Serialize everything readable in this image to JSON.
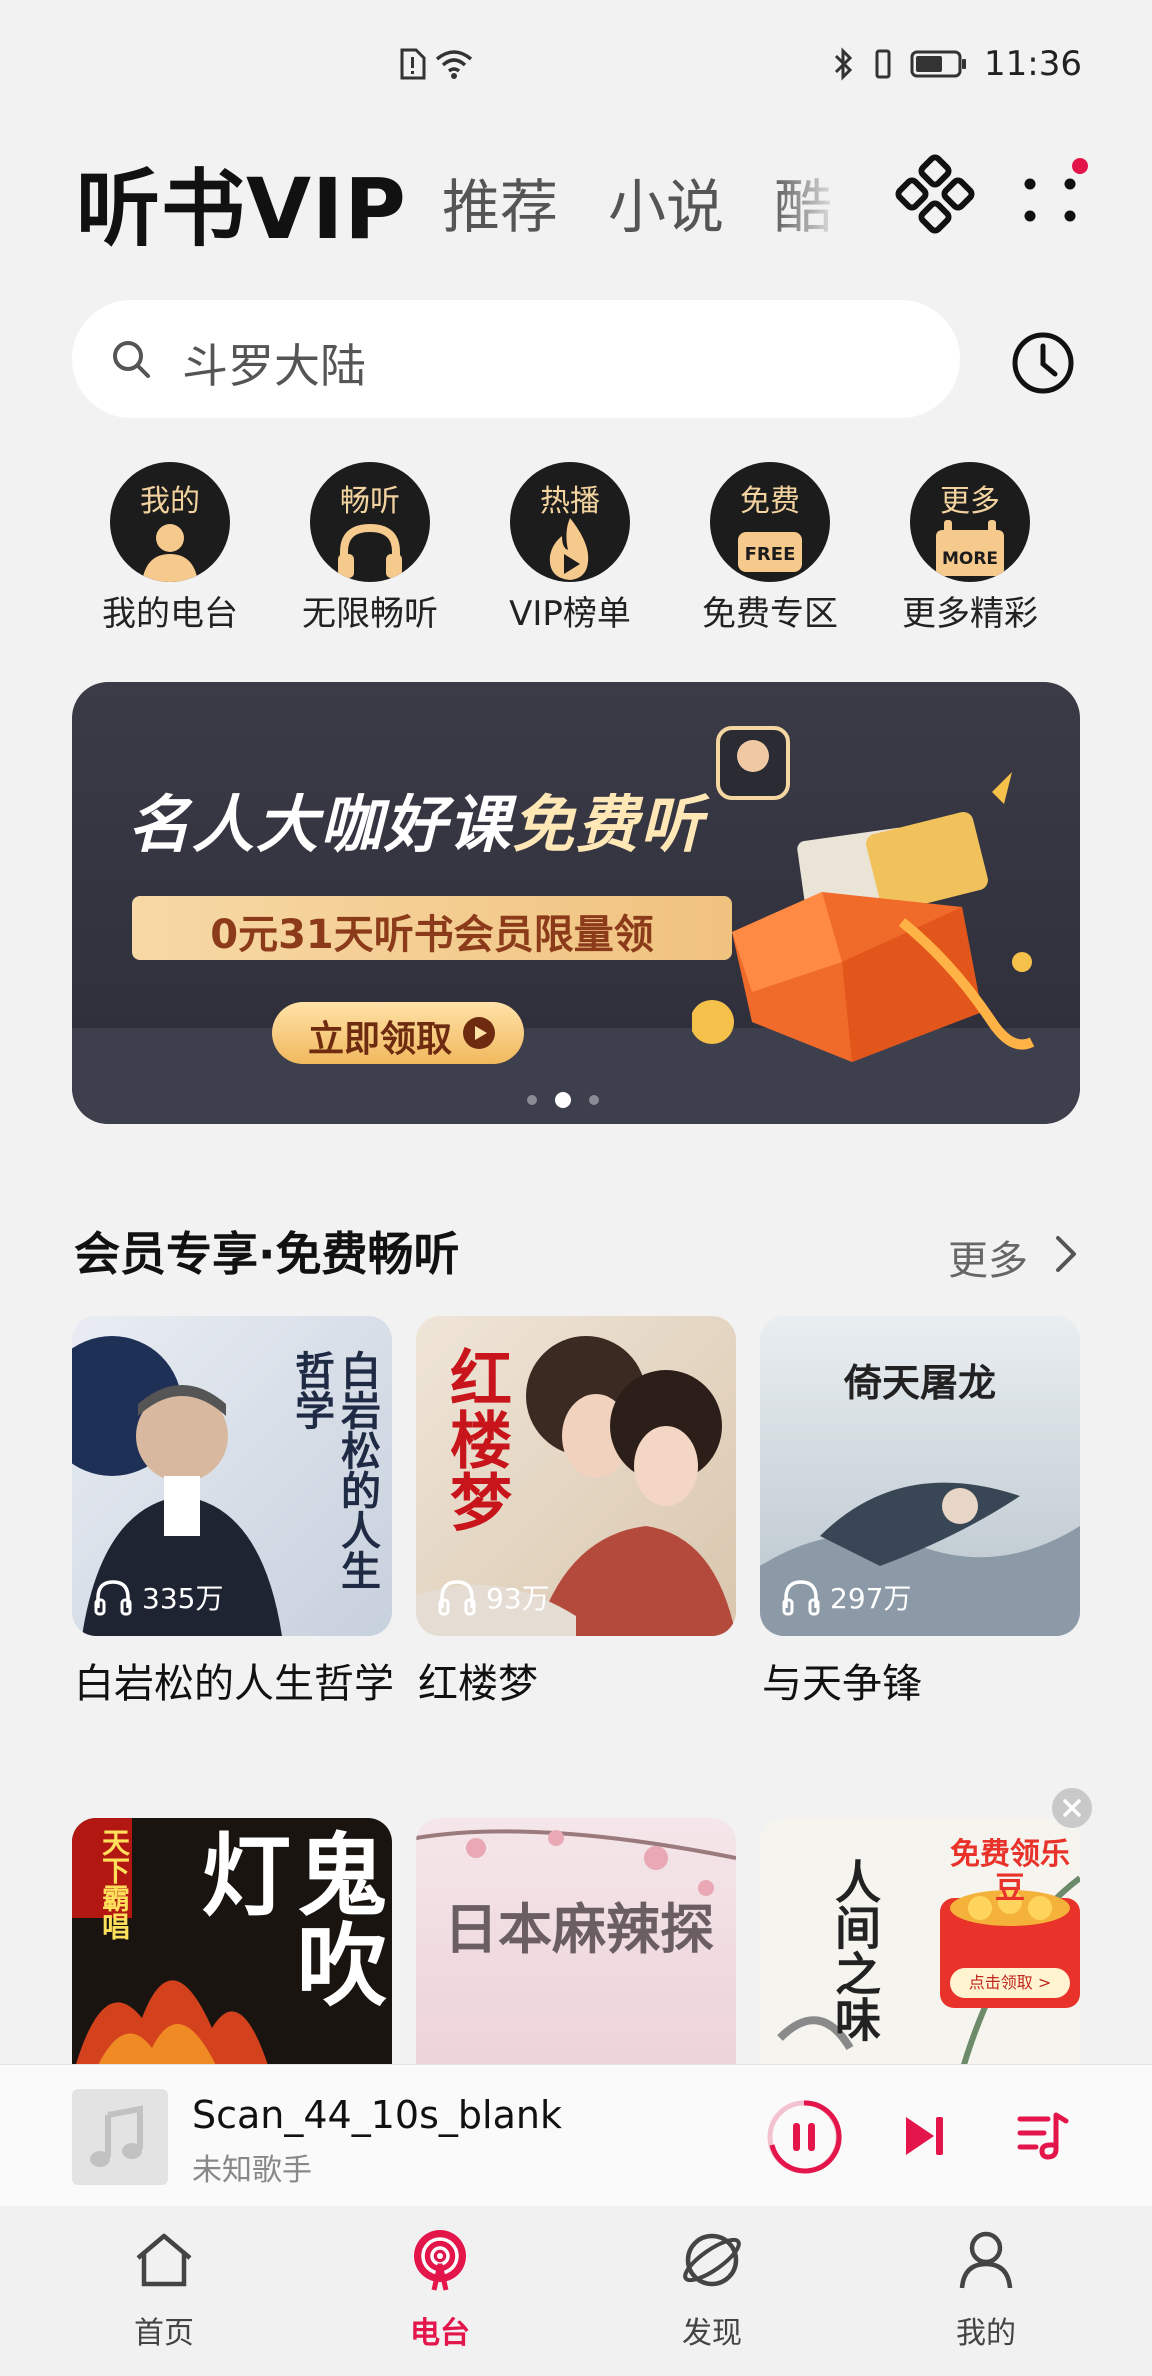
{
  "status_bar": {
    "time": "11:36"
  },
  "header": {
    "title": "听书VIP",
    "tabs": [
      "推荐",
      "小说",
      "酷"
    ]
  },
  "search": {
    "placeholder": "斗罗大陆"
  },
  "quick_entries": [
    {
      "badge": "我的",
      "label": "我的电台",
      "icon": "person-icon"
    },
    {
      "badge": "畅听",
      "label": "无限畅听",
      "icon": "headphones-icon"
    },
    {
      "badge": "热播",
      "label": "VIP榜单",
      "icon": "flame-play-icon"
    },
    {
      "badge": "免费",
      "label": "免费专区",
      "icon": "free-tag-icon",
      "tag": "FREE"
    },
    {
      "badge": "更多",
      "label": "更多精彩",
      "icon": "more-tag-icon",
      "tag": "MORE"
    }
  ],
  "banner": {
    "headline_a": "名人大咖好课",
    "headline_b": "免费听",
    "sub": "0元31天听书会员限量领",
    "cta": "立即领取",
    "page_index": 2,
    "page_count": 3
  },
  "section": {
    "title": "会员专享·免费畅听",
    "more": "更多"
  },
  "books": [
    {
      "title": "白岩松的人生哲学",
      "plays": "335万",
      "cover_text": "白岩松的人生哲学"
    },
    {
      "title": "红楼梦",
      "plays": "93万",
      "cover_text": "红楼梦"
    },
    {
      "title": "与天争锋",
      "plays": "297万",
      "cover_text": "倚天屠龙"
    }
  ],
  "books_row2": [
    {
      "cover_text": "鬼吹灯",
      "side_text": "天下霸唱"
    },
    {
      "cover_text": "日本麻辣探"
    },
    {
      "cover_text": "人间之味",
      "promo": "免费领乐豆",
      "promo_cta": "点击领取 >"
    }
  ],
  "player": {
    "title": "Scan_44_10s_blank",
    "artist": "未知歌手",
    "accent": "#e3154b"
  },
  "bottom_nav": [
    {
      "label": "首页",
      "icon": "home-icon"
    },
    {
      "label": "电台",
      "icon": "radio-icon",
      "active": true
    },
    {
      "label": "发现",
      "icon": "discover-icon"
    },
    {
      "label": "我的",
      "icon": "profile-icon"
    }
  ]
}
